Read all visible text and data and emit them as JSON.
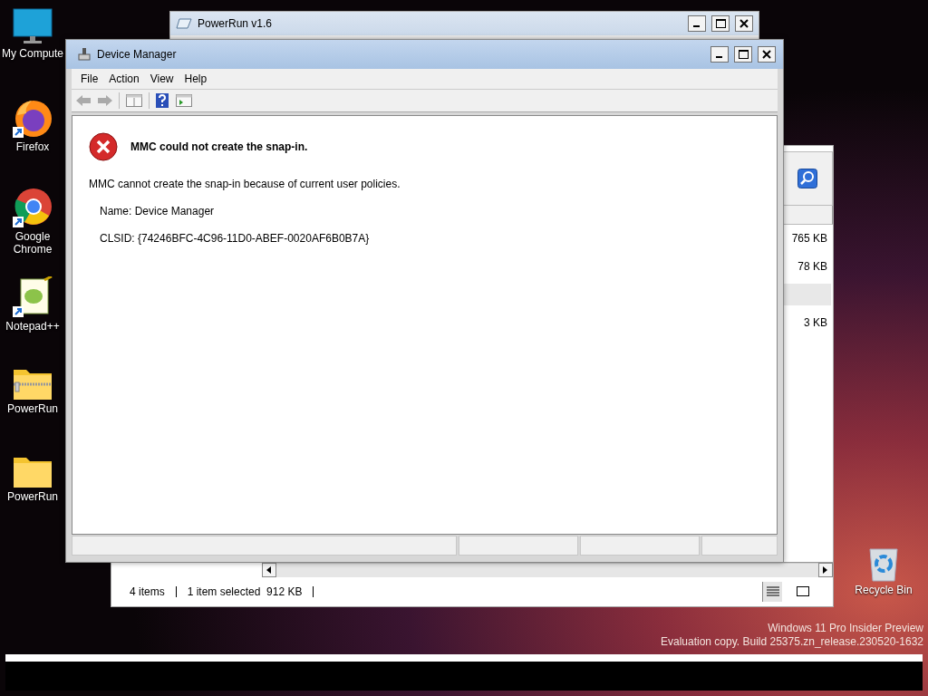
{
  "desktop": {
    "icons": [
      {
        "label": "My Compute",
        "kind": "computer"
      },
      {
        "label": "Firefox",
        "kind": "firefox"
      },
      {
        "label": "Google Chrome",
        "kind": "chrome"
      },
      {
        "label": "Notepad++",
        "kind": "notepad"
      },
      {
        "label": "PowerRun",
        "kind": "zip-folder"
      },
      {
        "label": "PowerRun",
        "kind": "folder"
      }
    ],
    "recycle_bin": {
      "label": "Recycle Bin"
    },
    "watermark": [
      "Windows 11 Pro Insider Preview",
      "Evaluation copy. Build 25375.zn_release.230520-1632"
    ]
  },
  "powerrun": {
    "title": "PowerRun v1.6",
    "rows": [
      {
        "size": "765 KB",
        "selected": false
      },
      {
        "size": "78 KB",
        "selected": false
      },
      {
        "selected": true
      },
      {
        "size": "3 KB",
        "selected": false
      }
    ],
    "status": [
      "4 items",
      "1 item selected  912 KB"
    ]
  },
  "device_manager": {
    "title": "Device Manager",
    "menu": [
      "File",
      "Action",
      "View",
      "Help"
    ],
    "error": {
      "heading": "MMC could not create the snap-in.",
      "message": "MMC cannot create the snap-in because of current user policies.",
      "details": [
        "Name: Device Manager",
        "CLSID: {74246BFC-4C96-11D0-ABEF-0020AF6B0B7A}"
      ]
    }
  }
}
